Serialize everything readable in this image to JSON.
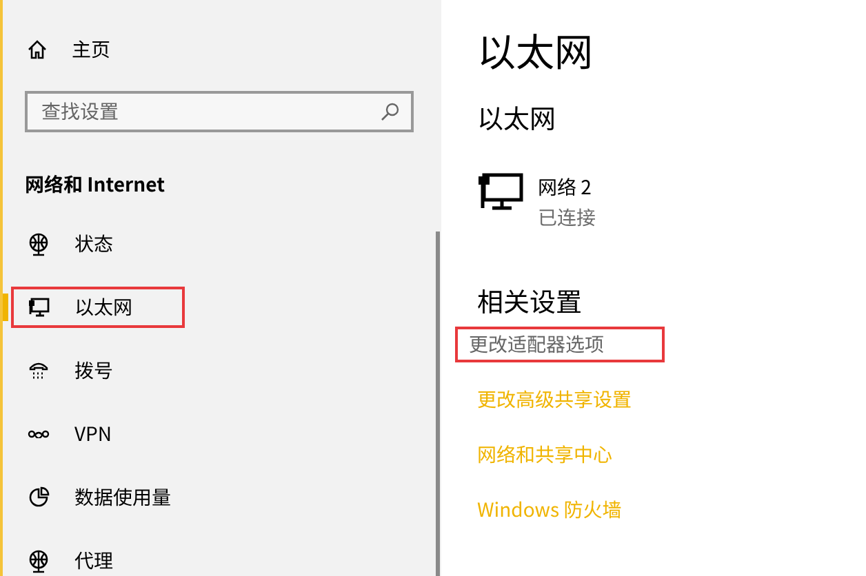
{
  "sidebar": {
    "home": {
      "label": "主页"
    },
    "search": {
      "placeholder": "查找设置"
    },
    "section_title": "网络和 Internet",
    "items": [
      {
        "label": "状态",
        "kind": "globe",
        "selected": false,
        "annotated": false
      },
      {
        "label": "以太网",
        "kind": "ethernet",
        "selected": true,
        "annotated": true
      },
      {
        "label": "拨号",
        "kind": "phone",
        "selected": false,
        "annotated": false
      },
      {
        "label": "VPN",
        "kind": "vpn",
        "selected": false,
        "annotated": false
      },
      {
        "label": "数据使用量",
        "kind": "pie",
        "selected": false,
        "annotated": false
      },
      {
        "label": "代理",
        "kind": "globe",
        "selected": false,
        "annotated": false
      }
    ]
  },
  "main": {
    "title": "以太网",
    "subtitle": "以太网",
    "network": {
      "name": "网络 2",
      "status": "已连接"
    },
    "related_title": "相关设置",
    "links": [
      {
        "label": "更改适配器选项",
        "hovered": true,
        "annotated": true
      },
      {
        "label": "更改高级共享设置",
        "hovered": false,
        "annotated": false
      },
      {
        "label": "网络和共享中心",
        "hovered": false,
        "annotated": false
      },
      {
        "label": "Windows 防火墙",
        "hovered": false,
        "annotated": false
      }
    ]
  }
}
